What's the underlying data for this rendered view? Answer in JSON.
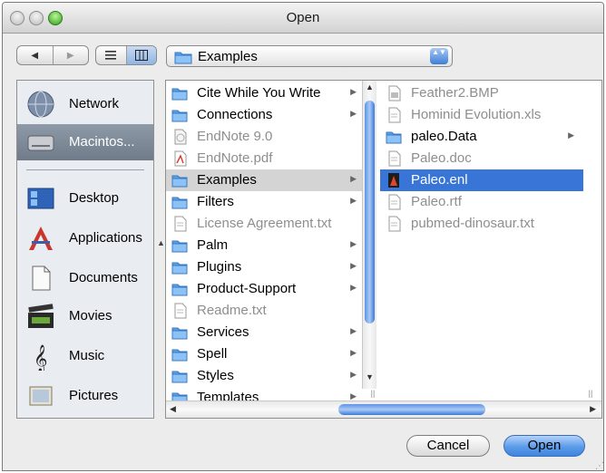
{
  "window": {
    "title": "Open"
  },
  "toolbar": {
    "back_glyph": "◀",
    "forward_glyph": "▶",
    "location": "Examples",
    "location_arrows": "▲▼"
  },
  "sidebar": {
    "items": [
      {
        "label": "Network",
        "icon": "network-icon",
        "selected": false
      },
      {
        "label": "Macintos...",
        "icon": "hard-drive-icon",
        "selected": true
      },
      {
        "label": "Desktop",
        "icon": "desktop-icon",
        "selected": false
      },
      {
        "label": "Applications",
        "icon": "applications-icon",
        "selected": false
      },
      {
        "label": "Documents",
        "icon": "documents-icon",
        "selected": false
      },
      {
        "label": "Movies",
        "icon": "movies-icon",
        "selected": false
      },
      {
        "label": "Music",
        "icon": "music-icon",
        "selected": false
      },
      {
        "label": "Pictures",
        "icon": "pictures-icon",
        "selected": false
      }
    ]
  },
  "browser": {
    "column1": [
      {
        "name": "Cite While You Write",
        "kind": "folder",
        "state": "normal"
      },
      {
        "name": "Connections",
        "kind": "folder",
        "state": "normal"
      },
      {
        "name": "EndNote 9.0",
        "kind": "app",
        "state": "dim"
      },
      {
        "name": "EndNote.pdf",
        "kind": "pdf",
        "state": "dim"
      },
      {
        "name": "Examples",
        "kind": "folder",
        "state": "highlighted"
      },
      {
        "name": "Filters",
        "kind": "folder",
        "state": "normal"
      },
      {
        "name": "License Agreement.txt",
        "kind": "doc",
        "state": "dim"
      },
      {
        "name": "Palm",
        "kind": "folder",
        "state": "normal"
      },
      {
        "name": "Plugins",
        "kind": "folder",
        "state": "normal"
      },
      {
        "name": "Product-Support",
        "kind": "folder",
        "state": "normal"
      },
      {
        "name": "Readme.txt",
        "kind": "doc",
        "state": "dim"
      },
      {
        "name": "Services",
        "kind": "folder",
        "state": "normal"
      },
      {
        "name": "Spell",
        "kind": "folder",
        "state": "normal"
      },
      {
        "name": "Styles",
        "kind": "folder",
        "state": "normal"
      },
      {
        "name": "Templates",
        "kind": "folder",
        "state": "normal"
      }
    ],
    "column2": [
      {
        "name": "Feather2.BMP",
        "kind": "image",
        "state": "dim"
      },
      {
        "name": "Hominid Evolution.xls",
        "kind": "doc",
        "state": "dim"
      },
      {
        "name": "paleo.Data",
        "kind": "folder",
        "state": "normal"
      },
      {
        "name": "Paleo.doc",
        "kind": "doc",
        "state": "dim"
      },
      {
        "name": "Paleo.enl",
        "kind": "enl",
        "state": "selected"
      },
      {
        "name": "Paleo.rtf",
        "kind": "doc",
        "state": "dim"
      },
      {
        "name": "pubmed-dinosaur.txt",
        "kind": "doc",
        "state": "dim"
      }
    ]
  },
  "buttons": {
    "cancel": "Cancel",
    "open": "Open"
  },
  "colors": {
    "selection": "#3875d7",
    "sidebar_selected": "#7b8795",
    "folder": "#5aa0e8"
  }
}
